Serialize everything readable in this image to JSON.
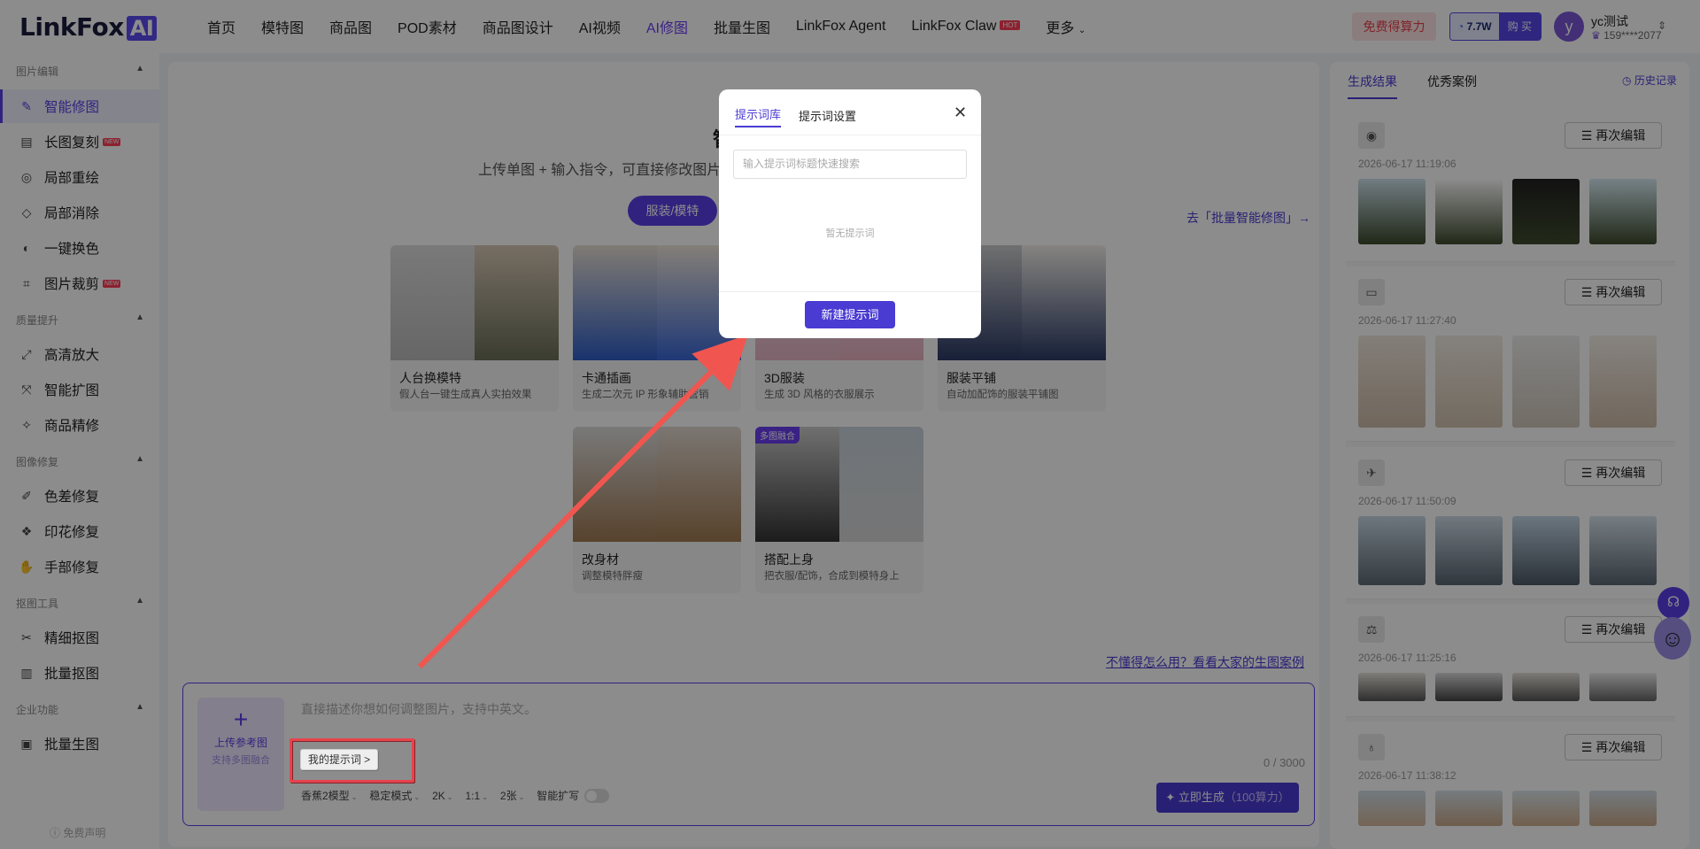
{
  "brand": {
    "name": "LinkFox",
    "ai": "AI"
  },
  "nav": [
    {
      "label": "首页"
    },
    {
      "label": "模特图"
    },
    {
      "label": "商品图"
    },
    {
      "label": "POD素材"
    },
    {
      "label": "商品图设计"
    },
    {
      "label": "AI视频"
    },
    {
      "label": "AI修图",
      "active": true
    },
    {
      "label": "批量生图"
    },
    {
      "label": "LinkFox Agent"
    },
    {
      "label": "LinkFox Claw",
      "badge": "HOT"
    },
    {
      "label": "更多"
    }
  ],
  "header": {
    "free_label": "免费得算力",
    "credits": "7.7W",
    "buy_label": "购 买",
    "avatar_letter": "y",
    "user_name": "yc测试",
    "user_phone": "159****2077"
  },
  "sidebar": {
    "sections": [
      {
        "title": "图片编辑",
        "items": [
          {
            "label": "智能修图",
            "active": true
          },
          {
            "label": "长图复刻",
            "badge": "NEW"
          },
          {
            "label": "局部重绘"
          },
          {
            "label": "局部消除"
          },
          {
            "label": "一键换色"
          },
          {
            "label": "图片裁剪",
            "badge": "NEW"
          }
        ]
      },
      {
        "title": "质量提升",
        "items": [
          {
            "label": "高清放大"
          },
          {
            "label": "智能扩图"
          },
          {
            "label": "商品精修"
          }
        ]
      },
      {
        "title": "图像修复",
        "items": [
          {
            "label": "色差修复"
          },
          {
            "label": "印花修复"
          },
          {
            "label": "手部修复"
          }
        ]
      },
      {
        "title": "抠图工具",
        "items": [
          {
            "label": "精细抠图"
          },
          {
            "label": "批量抠图"
          }
        ]
      },
      {
        "title": "企业功能",
        "items": [
          {
            "label": "批量生图"
          }
        ]
      }
    ],
    "disclaimer": "免费声明"
  },
  "main": {
    "title": "智",
    "subtitle": "上传单图 + 输入指令，可直接修改图片，上传多图 + 输入指令，可融合生成新图",
    "category": "服装/模特",
    "batch_link": "去「批量智能修图」→",
    "cards": [
      {
        "title": "人台换模特",
        "desc": "假人台一键生成真人实拍效果"
      },
      {
        "title": "卡通插画",
        "desc": "生成二次元 IP 形象辅助营销"
      },
      {
        "title": "3D服装",
        "desc": "生成 3D 风格的衣服展示"
      },
      {
        "title": "服装平铺",
        "desc": "自动加配饰的服装平铺图"
      },
      {
        "title": "改身材",
        "desc": "调整模特胖瘦"
      },
      {
        "title": "搭配上身",
        "desc": "把衣服/配饰，合成到模特身上",
        "tag": "多图融合"
      }
    ],
    "help_link": "不懂得怎么用？看看大家的生图案例"
  },
  "composer": {
    "upload_label": "上传参考图",
    "upload_sub": "支持多图融合",
    "placeholder": "直接描述你想如何调整图片，支持中英文。",
    "my_prompt": "我的提示词 >",
    "counter": "0 / 3000",
    "options": [
      "香蕉2模型",
      "稳定模式",
      "2K",
      "1:1",
      "2张"
    ],
    "smart_expand": "智能扩写",
    "generate_label": "立即生成",
    "generate_cost": "（100算力）"
  },
  "right_panel": {
    "tabs": [
      "生成结果",
      "优秀案例"
    ],
    "history": "历史记录",
    "edit_label": "再次编辑",
    "results": [
      {
        "date": "2026-06-17 11:19:06",
        "thumb_icon": "atv-icon"
      },
      {
        "date": "2026-06-17 11:27:40",
        "thumb_icon": "laptop-icon"
      },
      {
        "date": "2026-06-17 11:50:09",
        "thumb_icon": "drone-icon"
      },
      {
        "date": "2026-06-17 11:25:16",
        "thumb_icon": "gym-icon"
      },
      {
        "date": "2026-06-17 11:38:12",
        "thumb_icon": "dress-icon"
      }
    ]
  },
  "modal": {
    "tab_library": "提示词库",
    "tab_settings": "提示词设置",
    "search_placeholder": "输入提示词标题快速搜索",
    "empty": "暂无提示词",
    "new_button": "新建提示词"
  },
  "colors": {
    "accent": "#4a3bd3",
    "highlight": "#e8434d",
    "annotation_arrow": "#f0564f"
  }
}
